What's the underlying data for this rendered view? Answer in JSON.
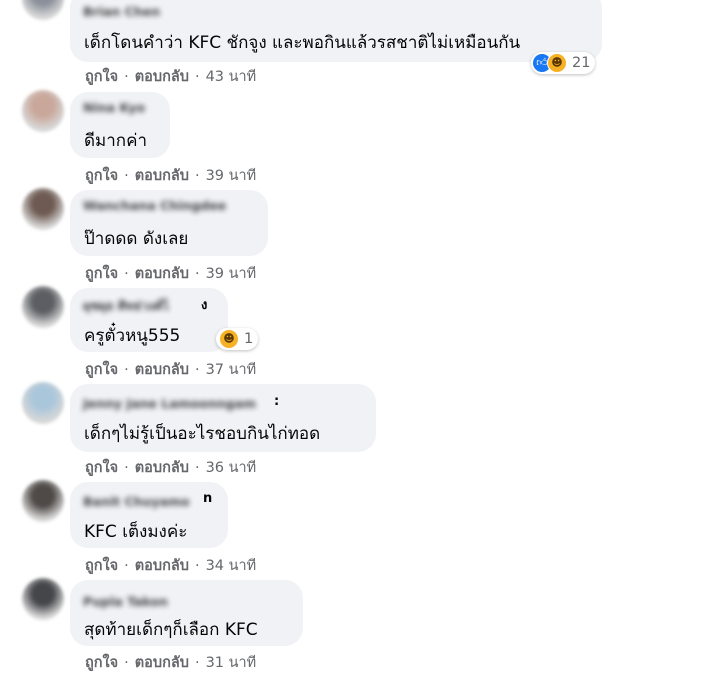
{
  "comments": [
    {
      "name": "Brian Chen",
      "name_tail": "",
      "text": "เด็กโดนคำว่า KFC ชักจูง และพอกินแล้วรสชาติไม่เหมือนกัน",
      "like": "ถูกใจ",
      "reply": "ตอบกลับ",
      "time": "43 นาที",
      "reactions": {
        "icons": [
          "like-icon",
          "haha-icon"
        ],
        "count": "21"
      },
      "avatar_color": "#8a8f99"
    },
    {
      "name": "Nina Kyo",
      "name_tail": "",
      "text": "ดีมากค่า",
      "like": "ถูกใจ",
      "reply": "ตอบกลับ",
      "time": "39 นาที",
      "avatar_color": "#c9a79a"
    },
    {
      "name": "Wanchana Chingdee",
      "name_tail": "",
      "text": "ป๊าดดด ดังเลย",
      "like": "ถูกใจ",
      "reply": "ตอบกลับ",
      "time": "39 นาที",
      "avatar_color": "#6e5a52"
    },
    {
      "name": "ผุซผุย ศิทธ่วงศ์ไ",
      "name_tail": "ง",
      "text": "ครูตั๋วหนู555",
      "like": "ถูกใจ",
      "reply": "ตอบกลับ",
      "time": "37 นาที",
      "reactions": {
        "icons": [
          "haha-icon"
        ],
        "count": "1"
      },
      "avatar_color": "#5c5e63"
    },
    {
      "name": "Jenny Jane Lamoonngam",
      "name_tail": ":",
      "text": "เด็กๆไม่รู้เป็นอะไรชอบกินไก่ทอด",
      "like": "ถูกใจ",
      "reply": "ตอบกลับ",
      "time": "36 นาที",
      "avatar_color": "#a9c6db"
    },
    {
      "name": "Banit Chuyamo",
      "name_tail": "n",
      "text": "KFC เต็งมงค่ะ",
      "like": "ถูกใจ",
      "reply": "ตอบกลับ",
      "time": "34 นาที",
      "avatar_color": "#4f4a47"
    },
    {
      "name": "Pupla Takon",
      "name_tail": "",
      "text": "สุดท้ายเด็กๆก็เลือก KFC",
      "like": "ถูกใจ",
      "reply": "ตอบกลับ",
      "time": "31 นาที",
      "avatar_color": "#45464a"
    }
  ]
}
